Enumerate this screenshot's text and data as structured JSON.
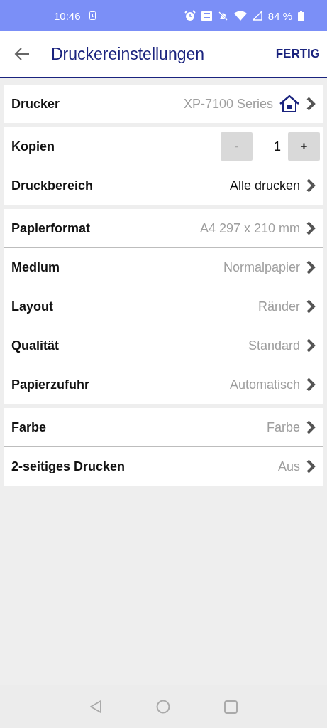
{
  "status_bar": {
    "time": "10:46",
    "battery": "84 %"
  },
  "header": {
    "title": "Druckereinstellungen",
    "action": "FERTIG"
  },
  "groups": [
    {
      "rows": [
        {
          "kind": "printer",
          "label": "Drucker",
          "value": "XP-7100 Series",
          "muted": true
        }
      ]
    },
    {
      "rows": [
        {
          "kind": "stepper",
          "label": "Kopien",
          "value": "1",
          "minus": "-",
          "plus": "+",
          "minus_disabled": true
        },
        {
          "kind": "link",
          "label": "Druckbereich",
          "value": "Alle drucken",
          "muted": false
        }
      ]
    },
    {
      "rows": [
        {
          "kind": "link",
          "label": "Papierformat",
          "value": "A4 297 x 210 mm",
          "muted": true
        },
        {
          "kind": "link",
          "label": "Medium",
          "value": "Normalpapier",
          "muted": true
        },
        {
          "kind": "link",
          "label": "Layout",
          "value": "Ränder",
          "muted": true
        },
        {
          "kind": "link",
          "label": "Qualität",
          "value": "Standard",
          "muted": true
        },
        {
          "kind": "link",
          "label": "Papierzufuhr",
          "value": "Automatisch",
          "muted": true
        }
      ]
    },
    {
      "rows": [
        {
          "kind": "link",
          "label": "Farbe",
          "value": "Farbe",
          "muted": true
        },
        {
          "kind": "link",
          "label": "2-seitiges Drucken",
          "value": "Aus",
          "muted": true
        }
      ]
    }
  ]
}
